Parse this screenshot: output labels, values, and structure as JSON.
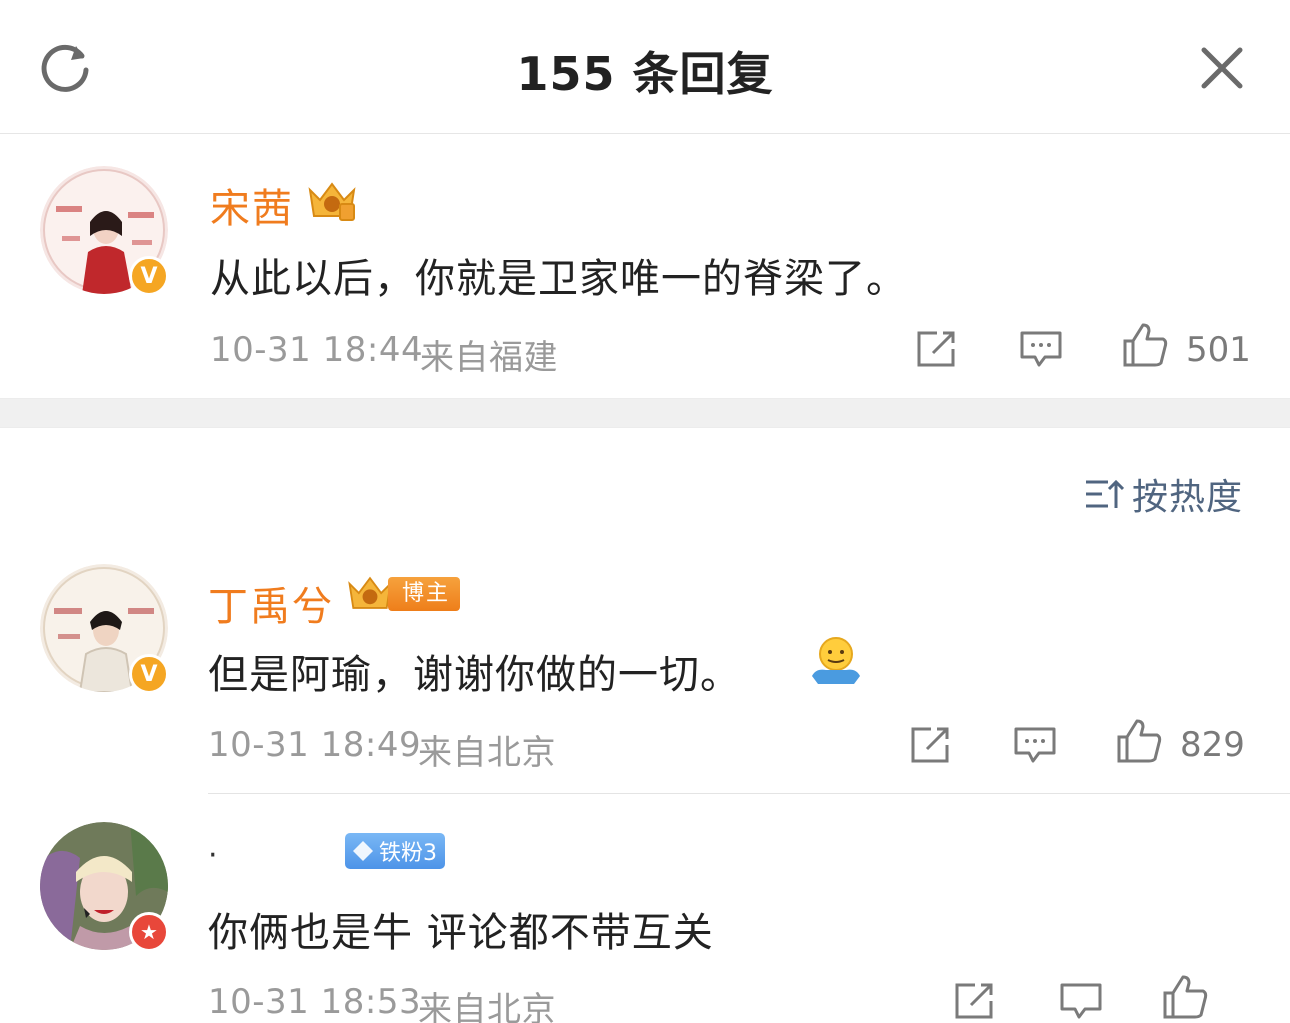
{
  "header": {
    "title": "155 条回复",
    "refresh_icon": "refresh-icon",
    "close_icon": "close-icon"
  },
  "root_comment": {
    "username": "宋茜",
    "avatar_badge": "V",
    "text": "从此以后，你就是卫家唯一的脊梁了。",
    "timestamp": "10-31 18:44",
    "location": "来自福建",
    "likes": "501"
  },
  "sort": {
    "label": "按热度",
    "icon": "sort-icon"
  },
  "replies": [
    {
      "username": "丁禹兮",
      "badge": "博主",
      "avatar_badge": "V",
      "text": "但是阿瑜，谢谢你做的一切。",
      "emoji": "hug-emoji",
      "timestamp": "10-31 18:49",
      "location": "来自北京",
      "likes": "829"
    },
    {
      "username": "·",
      "fan_badge": "铁粉3",
      "avatar_badge": "★",
      "text": "你俩也是牛 评论都不带互关",
      "timestamp": "10-31 18:53",
      "location": "来自北京"
    }
  ],
  "colors": {
    "username": "#f07c1e",
    "meta": "#9a9a9a",
    "sort": "#506580",
    "verified": "#f5a623",
    "fan_badge": "#4d94e8"
  }
}
